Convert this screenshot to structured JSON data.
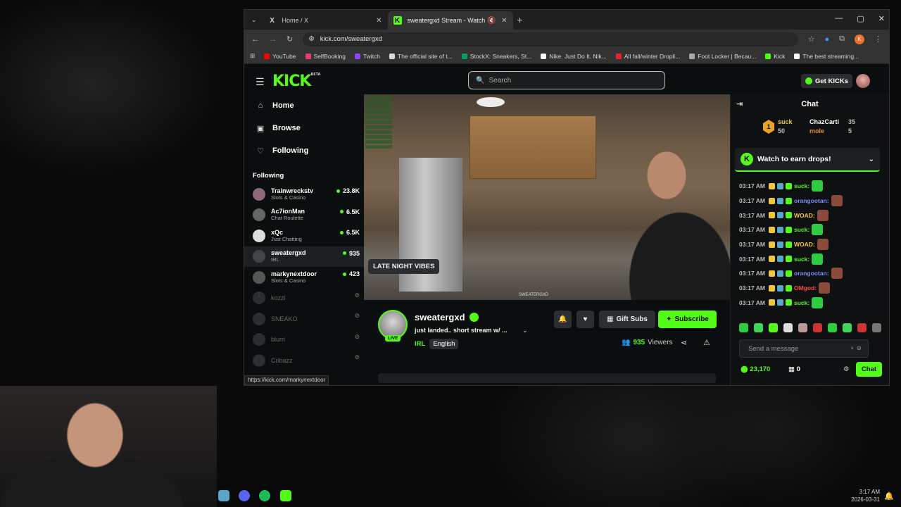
{
  "browser": {
    "tabs": [
      {
        "label": "Home / X",
        "icon": "X"
      },
      {
        "label": "sweatergxd Stream - Watch",
        "icon": "K"
      }
    ],
    "url": "kick.com/sweatergxd",
    "bookmarks": [
      "YouTube",
      "SelfBooking",
      "Twitch",
      "The official site of t...",
      "StockX: Sneakers, St...",
      "Nike. Just Do It. Nik...",
      "All fall/winter Dropli...",
      "Foot Locker | Becau...",
      "Kick",
      "The best streaming..."
    ],
    "status_url": "https://kick.com/markynextdoor"
  },
  "kick": {
    "logo": "KICK",
    "logo_badge": "BETA",
    "search_placeholder": "Search",
    "get_kicks": "Get KICKs",
    "nav": [
      {
        "label": "Home",
        "icon": "⌂"
      },
      {
        "label": "Browse",
        "icon": "▣"
      },
      {
        "label": "Following",
        "icon": "♡"
      }
    ],
    "following_header": "Following",
    "following": [
      {
        "name": "Trainwreckstv",
        "category": "Slots & Casino",
        "viewers": "23.8K",
        "live": true
      },
      {
        "name": "Ac7ionMan",
        "category": "Chat Roulette",
        "viewers": "6.5K",
        "live": true
      },
      {
        "name": "xQc",
        "category": "Just Chatting",
        "viewers": "6.5K",
        "live": true
      },
      {
        "name": "sweatergxd",
        "category": "IRL",
        "viewers": "935",
        "live": true
      },
      {
        "name": "markynextdoor",
        "category": "Slots & Casino",
        "viewers": "423",
        "live": true
      },
      {
        "name": "kozzi",
        "category": "",
        "viewers": "",
        "live": false
      },
      {
        "name": "SNEAKO",
        "category": "",
        "viewers": "",
        "live": false
      },
      {
        "name": "blurri",
        "category": "",
        "viewers": "",
        "live": false
      },
      {
        "name": "Cribazz",
        "category": "",
        "viewers": "",
        "live": false
      }
    ],
    "tooltip": "LATE NIGHT VIBES",
    "video_watermark": "SWEATERGXD",
    "channel": {
      "name": "sweatergxd",
      "live_badge": "LIVE",
      "title": "just landed.. short stream w/ ...",
      "category": "IRL",
      "language": "English",
      "viewers": "935",
      "viewers_label": "Viewers",
      "gift_subs": "Gift Subs",
      "subscribe": "Subscribe"
    },
    "chat": {
      "header": "Chat",
      "pinned": {
        "rank": "1",
        "user1": "suck",
        "count1": "50",
        "user2": "ChazCarti",
        "count2": "35",
        "user3": "mole",
        "count3": "5"
      },
      "drops_banner": "Watch to earn drops!",
      "messages": [
        {
          "time": "03:17 AM",
          "user": "suck:",
          "color": "#53fc18"
        },
        {
          "time": "03:17 AM",
          "user": "orangootan:",
          "color": "#7b8cff"
        },
        {
          "time": "03:17 AM",
          "user": "WOAD:",
          "color": "#f0c93a"
        },
        {
          "time": "03:17 AM",
          "user": "suck:",
          "color": "#53fc18"
        },
        {
          "time": "03:17 AM",
          "user": "WOAD:",
          "color": "#f0c93a"
        },
        {
          "time": "03:17 AM",
          "user": "suck:",
          "color": "#53fc18"
        },
        {
          "time": "03:17 AM",
          "user": "orangootan:",
          "color": "#7b8cff"
        },
        {
          "time": "03:17 AM",
          "user": "OMgod:",
          "color": "#ff4d4d"
        },
        {
          "time": "03:17 AM",
          "user": "suck:",
          "color": "#53fc18"
        }
      ],
      "send_placeholder": "Send a message",
      "kicks_count": "23,170",
      "gift_count": "0",
      "chat_button": "Chat"
    }
  },
  "taskbar": {
    "time": "3:17 AM",
    "date": "2026-03-31"
  },
  "colors": {
    "accent": "#53fc18",
    "bg": "#0b0e0f"
  }
}
